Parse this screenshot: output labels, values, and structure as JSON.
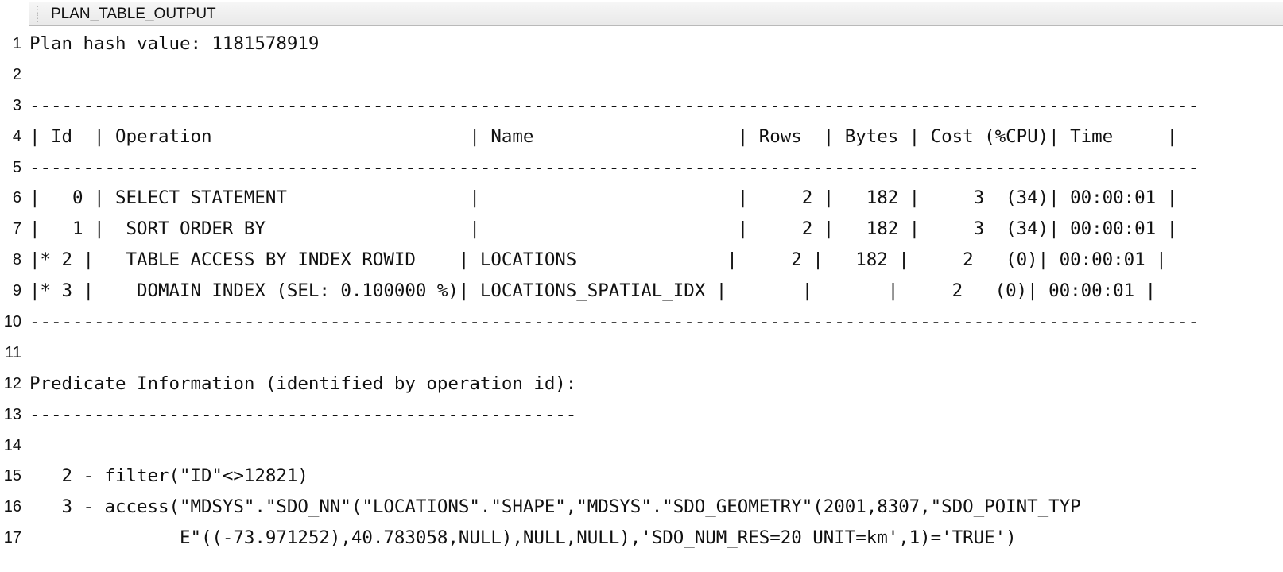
{
  "header": {
    "column_label": "PLAN_TABLE_OUTPUT",
    "grip_icon": "column-resize-grip"
  },
  "lines": [
    {
      "no": "1",
      "text": "Plan hash value: 1181578919"
    },
    {
      "no": "2",
      "text": ""
    },
    {
      "no": "3",
      "text": "-------------------------------------------------------------------------------------------------------------"
    },
    {
      "no": "4",
      "text": "| Id  | Operation                        | Name                   | Rows  | Bytes | Cost (%CPU)| Time     |"
    },
    {
      "no": "5",
      "text": "-------------------------------------------------------------------------------------------------------------"
    },
    {
      "no": "6",
      "text": "|   0 | SELECT STATEMENT                 |                        |     2 |   182 |     3  (34)| 00:00:01 |"
    },
    {
      "no": "7",
      "text": "|   1 |  SORT ORDER BY                   |                        |     2 |   182 |     3  (34)| 00:00:01 |"
    },
    {
      "no": "8",
      "text": "|* 2 |   TABLE ACCESS BY INDEX ROWID    | LOCATIONS              |     2 |   182 |     2   (0)| 00:00:01 |"
    },
    {
      "no": "9",
      "text": "|* 3 |    DOMAIN INDEX (SEL: 0.100000 %)| LOCATIONS_SPATIAL_IDX |       |       |     2   (0)| 00:00:01 |"
    },
    {
      "no": "10",
      "text": "-------------------------------------------------------------------------------------------------------------"
    },
    {
      "no": "11",
      "text": ""
    },
    {
      "no": "12",
      "text": "Predicate Information (identified by operation id):"
    },
    {
      "no": "13",
      "text": "---------------------------------------------------"
    },
    {
      "no": "14",
      "text": ""
    },
    {
      "no": "15",
      "text": "   2 - filter(\"ID\"<>12821)"
    },
    {
      "no": "16",
      "text": "   3 - access(\"MDSYS\".\"SDO_NN\"(\"LOCATIONS\".\"SHAPE\",\"MDSYS\".\"SDO_GEOMETRY\"(2001,8307,\"SDO_POINT_TYP"
    },
    {
      "no": "17",
      "text": "              E\"((-73.971252),40.783058,NULL),NULL,NULL),'SDO_NUM_RES=20 UNIT=km',1)='TRUE')"
    }
  ]
}
